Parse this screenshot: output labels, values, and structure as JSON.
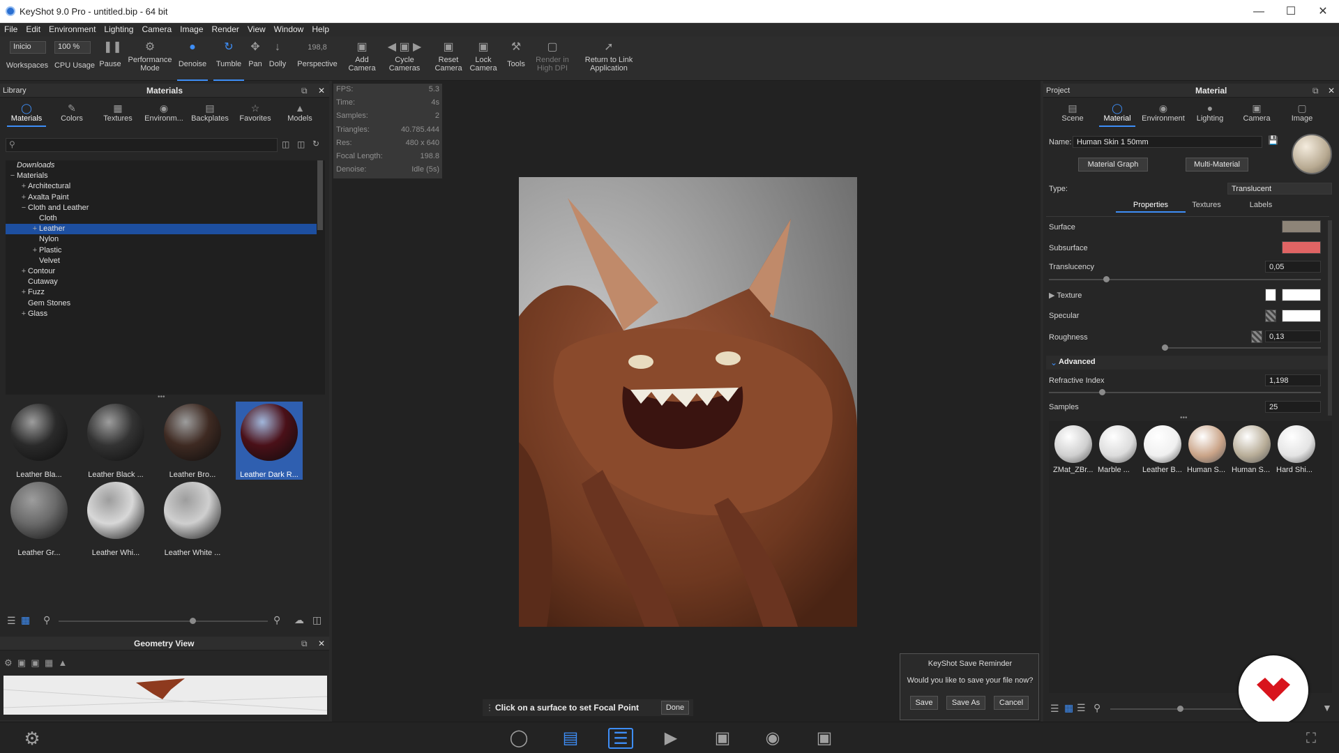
{
  "window": {
    "title": "KeyShot 9.0 Pro  -  untitled.bip  - 64 bit"
  },
  "menu": [
    "File",
    "Edit",
    "Environment",
    "Lighting",
    "Camera",
    "Image",
    "Render",
    "View",
    "Window",
    "Help"
  ],
  "toolbar": {
    "workspace_value": "Inicio",
    "workspace_label": "Workspaces",
    "cpu_value": "100 %",
    "cpu_label": "CPU Usage",
    "pause": "Pause",
    "performance": "Performance Mode",
    "denoise": "Denoise",
    "tumble": "Tumble",
    "pan": "Pan",
    "dolly": "Dolly",
    "perspective_value": "198,8",
    "perspective": "Perspective",
    "add_camera": "Add Camera",
    "cycle_cameras": "Cycle Cameras",
    "reset_camera": "Reset Camera",
    "lock_camera": "Lock Camera",
    "tools": "Tools",
    "render_high_dpi": "Render in High DPI",
    "return_link": "Return to Link Application"
  },
  "library": {
    "panel_left": "Library",
    "panel_title": "Materials",
    "tabs": [
      "Materials",
      "Colors",
      "Textures",
      "Environm...",
      "Backplates",
      "Favorites",
      "Models"
    ],
    "tree": [
      {
        "label": "Downloads",
        "exp": "",
        "indent": 0,
        "italic": true
      },
      {
        "label": "Materials",
        "exp": "−",
        "indent": 0
      },
      {
        "label": "Architectural",
        "exp": "+",
        "indent": 1
      },
      {
        "label": "Axalta Paint",
        "exp": "+",
        "indent": 1
      },
      {
        "label": "Cloth and Leather",
        "exp": "−",
        "indent": 1
      },
      {
        "label": "Cloth",
        "exp": "",
        "indent": 2
      },
      {
        "label": "Leather",
        "exp": "+",
        "indent": 2,
        "selected": true
      },
      {
        "label": "Nylon",
        "exp": "",
        "indent": 2
      },
      {
        "label": "Plastic",
        "exp": "+",
        "indent": 2
      },
      {
        "label": "Velvet",
        "exp": "",
        "indent": 2
      },
      {
        "label": "Contour",
        "exp": "+",
        "indent": 1
      },
      {
        "label": "Cutaway",
        "exp": "",
        "indent": 1
      },
      {
        "label": "Fuzz",
        "exp": "+",
        "indent": 1
      },
      {
        "label": "Gem Stones",
        "exp": "",
        "indent": 1
      },
      {
        "label": "Glass",
        "exp": "+",
        "indent": 1
      }
    ],
    "thumbs": [
      {
        "label": "Leather Bla...",
        "color": "#2a2a2a"
      },
      {
        "label": "Leather Black ...",
        "color": "#333333"
      },
      {
        "label": "Leather Bro...",
        "color": "#3e2a22"
      },
      {
        "label": "Leather Dark R...",
        "color": "#4a1018",
        "selected": true
      },
      {
        "label": "Leather Gr...",
        "color": "#6a6a6a"
      },
      {
        "label": "Leather Whi...",
        "color": "#d8d8d8"
      },
      {
        "label": "Leather White ...",
        "color": "#cfcfcf"
      }
    ]
  },
  "geometry": {
    "title": "Geometry View"
  },
  "stats": [
    {
      "k": "FPS:",
      "v": "5.3"
    },
    {
      "k": "Time:",
      "v": "4s"
    },
    {
      "k": "Samples:",
      "v": "2"
    },
    {
      "k": "Triangles:",
      "v": "40.785.444"
    },
    {
      "k": "Res:",
      "v": "480 x 640"
    },
    {
      "k": "Focal Length:",
      "v": "198.8"
    },
    {
      "k": "Denoise:",
      "v": "Idle (5s)"
    }
  ],
  "focal_bar": {
    "text": "Click on a surface to set Focal Point",
    "done": "Done"
  },
  "reminder": {
    "title": "KeyShot Save Reminder",
    "message": "Would you like to save your file now?",
    "save": "Save",
    "save_as": "Save As",
    "cancel": "Cancel"
  },
  "project": {
    "panel_left": "Project",
    "panel_title": "Material",
    "tabs": [
      "Scene",
      "Material",
      "Environment",
      "Lighting",
      "Camera",
      "Image"
    ],
    "name_label": "Name:",
    "name_value": "Human Skin 1 50mm",
    "material_graph": "Material Graph",
    "multi_material": "Multi-Material",
    "type_label": "Type:",
    "type_value": "Translucent",
    "subtabs": [
      "Properties",
      "Textures",
      "Labels"
    ],
    "surface": "Surface",
    "surface_color": "#8d8478",
    "subsurface": "Subsurface",
    "subsurface_color": "#e06464",
    "translucency": "Translucency",
    "translucency_value": "0,05",
    "texture": "Texture",
    "specular": "Specular",
    "roughness": "Roughness",
    "roughness_value": "0,13",
    "advanced": "Advanced",
    "refractive_index": "Refractive Index",
    "refractive_value": "1,198",
    "samples": "Samples",
    "samples_value": "25",
    "balls": [
      {
        "label": "ZMat_ZBr...",
        "color": "#cfcfcf"
      },
      {
        "label": "Marble ...",
        "color": "#dcdcdc"
      },
      {
        "label": "Leather B...",
        "color": "#f0f0f0"
      },
      {
        "label": "Human S...",
        "color": "#caa488"
      },
      {
        "label": "Human S...",
        "color": "#b8ad98"
      },
      {
        "label": "Hard Shi...",
        "color": "#e4e4e4"
      }
    ]
  },
  "accent": "#3e8ef7"
}
